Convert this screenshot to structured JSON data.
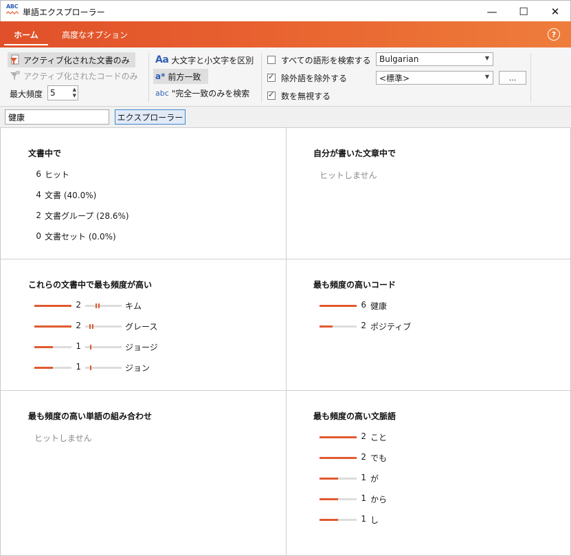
{
  "window": {
    "title": "単語エクスプローラー",
    "icon_text": "ABC",
    "min_symbol": "—",
    "max_symbol": "☐",
    "close_symbol": "✕"
  },
  "colors": {
    "accent": "#e8612f",
    "bar": "#e05a30",
    "focus_border": "#3d86cf"
  },
  "tabs": [
    {
      "label": "ホーム",
      "active": true
    },
    {
      "label": "高度なオプション",
      "active": false
    }
  ],
  "help_symbol": "?",
  "ribbon": {
    "active_docs_label": "アクティブ化された文書のみ",
    "active_codes_label": "アクティブ化されたコードのみ",
    "max_freq_label": "最大頻度",
    "max_freq_value": "5",
    "case_icon": "Aa",
    "case_label": "大文字と小文字を区別",
    "prefix_icon": "a*",
    "prefix_label": "前方一致",
    "exact_icon": "abc",
    "exact_label": "\"完全一致のみを検索",
    "all_forms": {
      "label": "すべての語形を検索する",
      "checked": false
    },
    "stop_words": {
      "label": "除外語を除外する",
      "checked": true
    },
    "ignore_numbers": {
      "label": "数を無視する",
      "checked": true
    },
    "language_value": "Bulgarian",
    "stoplist_value": "<標準>",
    "dots_label": "..."
  },
  "search": {
    "value": "健康",
    "button_label": "エクスプローラー"
  },
  "panels": {
    "in_docs": {
      "title": "文書中で",
      "rows": [
        {
          "num": "6",
          "label": "ヒット"
        },
        {
          "num": "4",
          "label": "文書 (40.0%)"
        },
        {
          "num": "2",
          "label": "文書グループ (28.6%)"
        },
        {
          "num": "0",
          "label": "文書セット (0.0%)"
        }
      ]
    },
    "in_memos": {
      "title": "自分が書いた文章中で",
      "empty": "ヒットしません"
    },
    "frequent_docs": {
      "title": "これらの文書中で最も頻度が高い",
      "rows": [
        {
          "num": "2",
          "label": "キム",
          "fraction": 1.0,
          "position": 0.28
        },
        {
          "num": "2",
          "label": "グレース",
          "fraction": 1.0,
          "position": 0.12
        },
        {
          "num": "1",
          "label": "ジョージ",
          "fraction": 0.5,
          "position": 0.14
        },
        {
          "num": "1",
          "label": "ジョン",
          "fraction": 0.5,
          "position": 0.14
        }
      ]
    },
    "frequent_codes": {
      "title": "最も頻度の高いコード",
      "rows": [
        {
          "num": "6",
          "label": "健康",
          "fraction": 1.0
        },
        {
          "num": "2",
          "label": "ポジティブ",
          "fraction": 0.35
        }
      ]
    },
    "word_combos": {
      "title": "最も頻度の高い単語の組み合わせ",
      "empty": "ヒットしません"
    },
    "context_words": {
      "title": "最も頻度の高い文脈語",
      "rows": [
        {
          "num": "2",
          "label": "こと",
          "fraction": 1.0
        },
        {
          "num": "2",
          "label": "でも",
          "fraction": 1.0
        },
        {
          "num": "1",
          "label": "が",
          "fraction": 0.5
        },
        {
          "num": "1",
          "label": "から",
          "fraction": 0.5
        },
        {
          "num": "1",
          "label": "し",
          "fraction": 0.5
        }
      ]
    }
  }
}
